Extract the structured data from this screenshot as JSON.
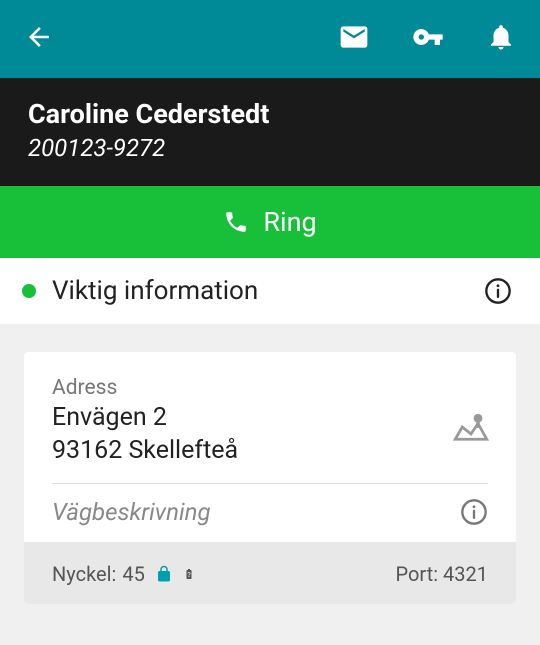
{
  "header": {
    "person_name": "Caroline Cederstedt",
    "person_id": "200123-9272"
  },
  "call": {
    "label": "Ring"
  },
  "important_info": {
    "label": "Viktig information"
  },
  "address_card": {
    "label": "Adress",
    "line1": "Envägen 2",
    "line2": "93162 Skellefteå",
    "directions_label": "Vägbeskrivning",
    "key_label": "Nyckel:",
    "key_value": "45",
    "port_label": "Port:",
    "port_value": "4321"
  },
  "colors": {
    "primary": "#008996",
    "accent": "#17c038",
    "dark": "#1a1a1a"
  }
}
